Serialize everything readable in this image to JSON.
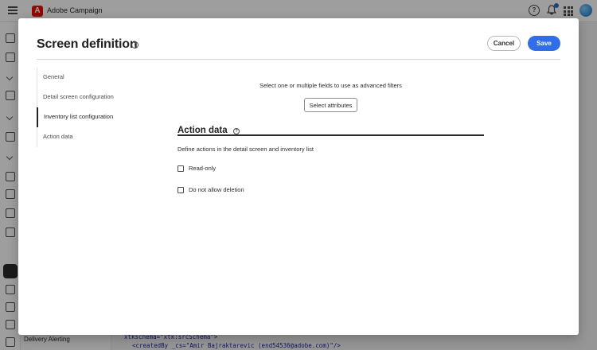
{
  "app": {
    "title": "Adobe Campaign",
    "logo_letter": "A",
    "brand_color": "#eb1000"
  },
  "topbar": {
    "icons": [
      "hamburger-icon",
      "help-icon",
      "bell-icon",
      "apps-grid-icon",
      "avatar"
    ]
  },
  "background": {
    "side_item": "Delivery Alerting",
    "code_line_1": "xtkschema=\"xtk:srcSchema\">",
    "code_line_2": "<createdBy _cs=\"Amir Bajraktarevic (end54536@adobe.com)\"/>"
  },
  "modal": {
    "title": "Screen definition",
    "help_symbol": "?",
    "cancel_label": "Cancel",
    "save_label": "Save",
    "accent_color": "#2f6ee8"
  },
  "nav": {
    "items": [
      {
        "label": "General",
        "active": false
      },
      {
        "label": "Detail screen configuration",
        "active": false
      },
      {
        "label": "Inventory list configuration",
        "active": true
      },
      {
        "label": "Action data",
        "active": false
      }
    ]
  },
  "content": {
    "filter_text": "Select one or multiple fields to use as advanced filters",
    "select_attributes_label": "Select attributes",
    "section_title": "Action data",
    "section_desc": "Define actions in the detail screen and inventory list",
    "checkboxes": [
      {
        "label": "Read-only",
        "checked": false
      },
      {
        "label": "Do not allow deletion",
        "checked": false
      }
    ]
  }
}
